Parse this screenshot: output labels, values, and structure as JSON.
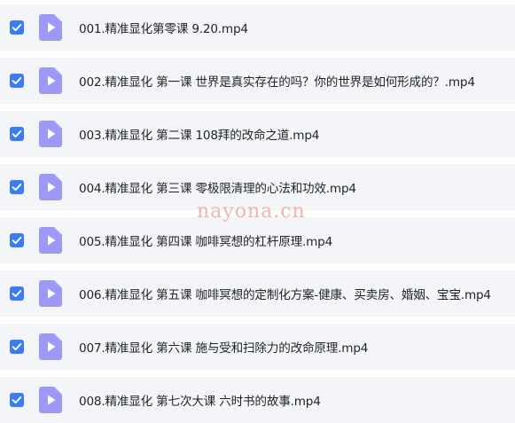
{
  "colors": {
    "checkbox": "#3b7bf6",
    "file_icon": "#9e99f7",
    "row_background": "#f4f5f8",
    "text": "#1f2329",
    "watermark": "#f2aaa8"
  },
  "files": [
    {
      "name": "001.精准显化第零课 9.20.mp4",
      "checked": true,
      "icon": "video-file-icon"
    },
    {
      "name": "002.精准显化 第一课 世界是真实存在的吗？你的世界是如何形成的？.mp4",
      "checked": true,
      "icon": "video-file-icon"
    },
    {
      "name": "003.精准显化 第二课 108拜的改命之道.mp4",
      "checked": true,
      "icon": "video-file-icon"
    },
    {
      "name": "004.精准显化 第三课 零极限清理的心法和功效.mp4",
      "checked": true,
      "icon": "video-file-icon"
    },
    {
      "name": "005.精准显化 第四课 咖啡冥想的杠杆原理.mp4",
      "checked": true,
      "icon": "video-file-icon"
    },
    {
      "name": "006.精准显化 第五课 咖啡冥想的定制化方案-健康、买卖房、婚姻、宝宝.mp4",
      "checked": true,
      "icon": "video-file-icon"
    },
    {
      "name": "007.精准显化 第六课 施与受和扫除力的改命原理.mp4",
      "checked": true,
      "icon": "video-file-icon"
    },
    {
      "name": "008.精准显化 第七次大课 六时书的故事.mp4",
      "checked": true,
      "icon": "video-file-icon"
    }
  ],
  "watermark": "nayona.cn"
}
